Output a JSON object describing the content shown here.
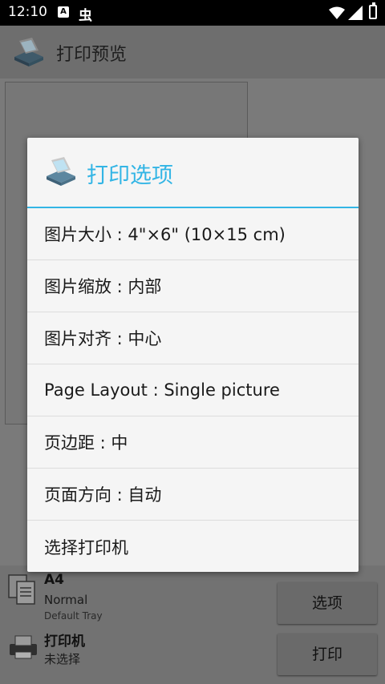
{
  "status_bar": {
    "time": "12:10",
    "ime_label": "A",
    "bug_glyph": "虫"
  },
  "app_bar": {
    "title": "打印预览"
  },
  "bottom_panel": {
    "paper": {
      "size": "A4",
      "type": "Normal",
      "tray": "Default Tray"
    },
    "printer": {
      "label": "打印机",
      "status": "未选择"
    },
    "options_button": "选项",
    "print_button": "打印"
  },
  "dialog": {
    "title": "打印选项",
    "accent_color": "#33b5e5",
    "options": [
      "图片大小 : 4\"×6\" (10×15 cm)",
      "图片缩放 : 内部",
      "图片对齐 : 中心",
      "Page Layout : Single picture",
      "页边距 : 中",
      "页面方向 : 自动",
      "选择打印机"
    ]
  }
}
